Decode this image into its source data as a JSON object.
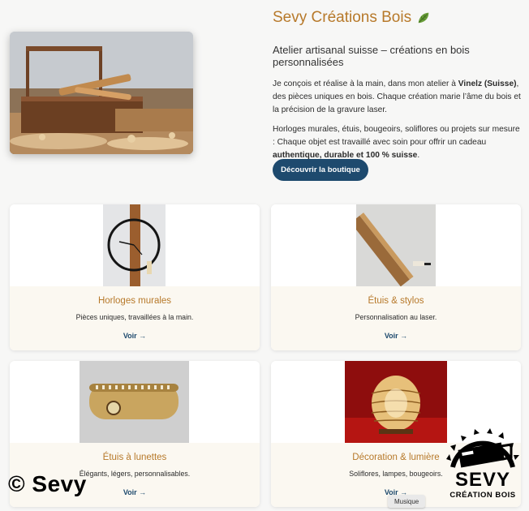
{
  "hero": {
    "brand_name": "Sevy Créations Bois",
    "brand_icon": "leaf-icon",
    "tagline": "Atelier artisanal suisse – créations en bois personnalisées",
    "p1_a": "Je conçois et réalise à la main, dans mon atelier à ",
    "p1_b": "Vinelz (Suisse)",
    "p1_c": ", des pièces uniques en bois. Chaque création marie l’âme du bois et la précision de la gravure laser.",
    "p2_a": "Horloges murales, étuis, bougeoirs, soliflores ou projets sur mesure : Chaque objet est travaillé avec soin pour offrir un cadeau ",
    "p2_b": "authentique, durable et 100 % suisse",
    "p2_c": ".",
    "cta_label": "Découvrir la boutique"
  },
  "cards": [
    {
      "title": "Horloges murales",
      "desc": "Pièces uniques, travaillées à la main.",
      "link": "Voir →"
    },
    {
      "title": "Étuis & stylos",
      "desc": "Personnalisation au laser.",
      "link": "Voir →"
    },
    {
      "title": "Étuis à lunettes",
      "desc": "Élégants, légers, personnalisables.",
      "link": "Voir →"
    },
    {
      "title": "Décoration & lumière",
      "desc": "Soliflores, lampes, bougeoirs.",
      "link": "Voir →"
    }
  ],
  "overlay": {
    "copyright": "© Sevy",
    "logo_big": "SEVY",
    "logo_small": "CRÉATION BOIS",
    "tooltip": "Musique"
  },
  "colors": {
    "accent": "#b7792a",
    "button": "#1e4a6e",
    "card_body": "#fbf8f1",
    "background": "#f7f7f6"
  }
}
